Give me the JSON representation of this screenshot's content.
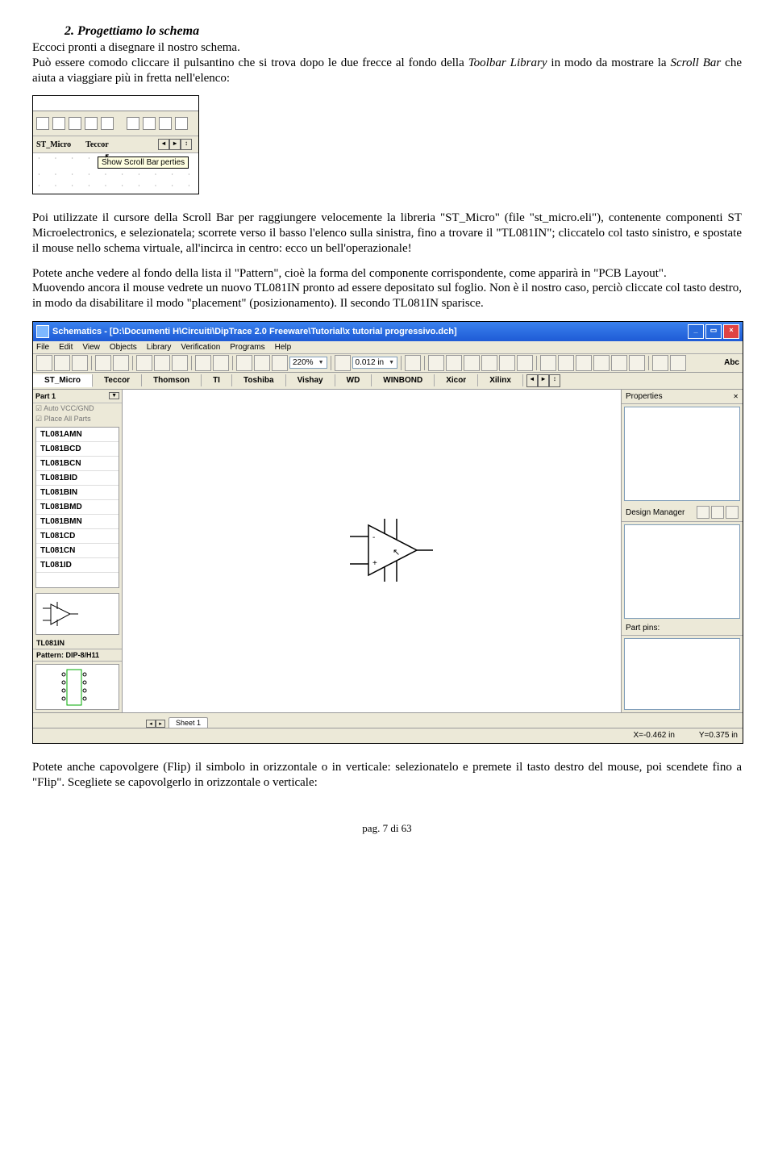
{
  "heading": "2. Progettiamo lo schema",
  "para1_a": "Eccoci pronti a disegnare il nostro schema.",
  "para1_b": "Può essere comodo cliccare il pulsantino che si trova dopo le due frecce al fondo della ",
  "para1_c": "Toolbar Library",
  "para1_d": " in modo da mostrare la ",
  "para1_e": "Scroll Bar",
  "para1_f": " che aiuta a viaggiare più in fretta nell'elenco:",
  "ss1": {
    "lib1": "ST_Micro",
    "lib2": "Teccor",
    "tooltip1": "Show Scroll Bar",
    "tooltip2": "perties"
  },
  "para2": "Poi utilizzate il cursore della Scroll Bar per raggiungere velocemente la libreria \"ST_Micro\" (file \"st_micro.eli\"), contenente componenti ST Microelectronics, e selezionatela; scorrete verso il basso l'elenco sulla sinistra, fino a trovare il \"TL081IN\"; cliccatelo col tasto sinistro, e spostate il mouse nello schema virtuale, all'incirca in centro: ecco un bell'operazionale!",
  "para3": "Potete anche vedere al fondo della lista il \"Pattern\", cioè la forma del componente corrispondente, come apparirà in \"PCB Layout\".",
  "para4": "Muovendo ancora il mouse vedrete un nuovo TL081IN pronto ad essere depositato sul foglio. Non è il nostro caso, perciò cliccate col tasto destro, in modo da disabilitare il modo \"placement\" (posizionamento). Il secondo TL081IN sparisce.",
  "ss2": {
    "title": "Schematics - [D:\\Documenti H\\Circuiti\\DipTrace 2.0 Freeware\\Tutorial\\x tutorial progressivo.dch]",
    "menus": [
      "File",
      "Edit",
      "View",
      "Objects",
      "Library",
      "Verification",
      "Programs",
      "Help"
    ],
    "zoom": "220%",
    "grid": "0.012 in",
    "abc": "Abc",
    "libs": [
      "ST_Micro",
      "Teccor",
      "Thomson",
      "TI",
      "Toshiba",
      "Vishay",
      "WD",
      "WINBOND",
      "Xicor",
      "Xilinx"
    ],
    "part_label": "Part 1",
    "chk1": "Auto VCC/GND",
    "chk2": "Place All Parts",
    "parts": [
      "TL081AMN",
      "TL081BCD",
      "TL081BCN",
      "TL081BID",
      "TL081BIN",
      "TL081BMD",
      "TL081BMN",
      "TL081CD",
      "TL081CN",
      "TL081ID"
    ],
    "selected_part": "TL081IN",
    "pattern": "Pattern: DIP-8/H11",
    "right1": "Properties",
    "right2": "Design Manager",
    "right3": "Part pins:",
    "sheet": "Sheet 1",
    "coordx": "X=-0.462 in",
    "coordy": "Y=0.375 in"
  },
  "para5": "Potete anche capovolgere (Flip) il simbolo in orizzontale o in verticale: selezionatelo e premete il tasto destro del mouse, poi scendete fino a \"Flip\". Scegliete se capovolgerlo in orizzontale o verticale:",
  "footer": "pag. 7 di 63"
}
